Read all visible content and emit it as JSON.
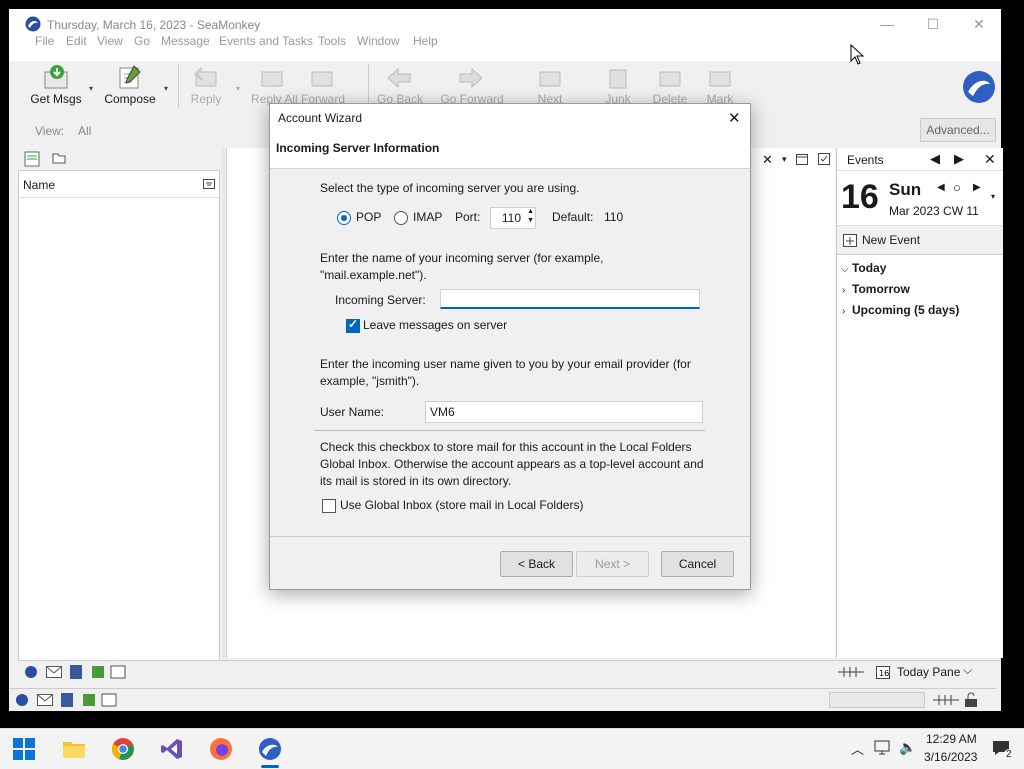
{
  "window": {
    "title": "Thursday, March 16, 2023 - SeaMonkey",
    "controls": {
      "minimize": "—",
      "maximize": "☐",
      "close": "✕"
    }
  },
  "menu": [
    "File",
    "Edit",
    "View",
    "Go",
    "Message",
    "Events and Tasks",
    "Tools",
    "Window",
    "Help"
  ],
  "toolbar": {
    "get_msgs": "Get Msgs",
    "compose": "Compose",
    "reply": "Reply",
    "reply_all_forward": "Reply All Forward",
    "go_back": "Go Back",
    "go_forward": "Go Forward",
    "next": "Next",
    "junk": "Junk",
    "delete": "Delete",
    "mark": "Mark"
  },
  "viewbar": {
    "label": "View:",
    "value": "All",
    "advanced": "Advanced..."
  },
  "folder_pane": {
    "column": "Name"
  },
  "events_pane": {
    "title": "Events",
    "day_number": "16",
    "day_name": "Sun",
    "month_week": "Mar 2023  CW 11",
    "new_event": "New Event",
    "groups": [
      "Today",
      "Tomorrow",
      "Upcoming (5 days)"
    ],
    "today_pane": "Today Pane"
  },
  "dialog": {
    "title": "Account Wizard",
    "heading": "Incoming Server Information",
    "server_type_prompt": "Select the type of incoming server you are using.",
    "pop_label": "POP",
    "imap_label": "IMAP",
    "port_label": "Port:",
    "port_value": "110",
    "default_label": "Default:",
    "default_value": "110",
    "server_prompt_line1": "Enter the name of your incoming server (for example,",
    "server_prompt_line2": "\"mail.example.net\").",
    "incoming_server_label": "Incoming Server:",
    "incoming_server_value": "",
    "leave_messages_label": "Leave messages on server",
    "leave_messages_checked": true,
    "username_prompt_line1": "Enter the incoming user name given to you by your email provider (for",
    "username_prompt_line2": "example, \"jsmith\").",
    "username_label": "User Name:",
    "username_value": "VM6",
    "global_inbox_line1": "Check this checkbox to store mail for this account in the Local Folders",
    "global_inbox_line2": "Global Inbox. Otherwise the account appears as a top-level account and",
    "global_inbox_line3": "its mail is stored in its own directory.",
    "global_inbox_label": "Use Global Inbox (store mail in Local Folders)",
    "global_inbox_checked": false,
    "back_button": "< Back",
    "next_button": "Next >",
    "cancel_button": "Cancel"
  },
  "taskbar": {
    "time": "12:29 AM",
    "date": "3/16/2023",
    "notifications": "2",
    "apps": [
      "start-icon",
      "file-explorer-icon",
      "chrome-icon",
      "visual-studio-icon",
      "firefox-icon",
      "seamonkey-icon"
    ]
  }
}
